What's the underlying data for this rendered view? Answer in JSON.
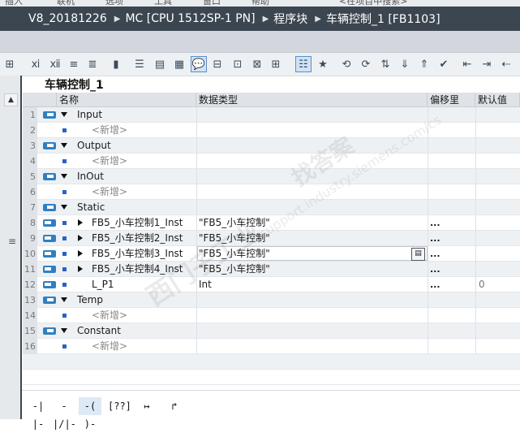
{
  "top_menu": [
    "插入",
    "联机",
    "选项",
    "工具",
    "窗口",
    "帮助"
  ],
  "top_search_placeholder": "<在项目中搜索>",
  "breadcrumb": [
    "V8_20181226",
    "MC [CPU 1512SP-1 PN]",
    "程序块",
    "车辆控制_1 [FB1103]"
  ],
  "block_title": "车辆控制_1",
  "columns": {
    "name": "名称",
    "datatype": "数据类型",
    "offset": "偏移里",
    "default": "默认值"
  },
  "rows": [
    {
      "n": "1",
      "kind": "section",
      "name": "Input"
    },
    {
      "n": "2",
      "kind": "add",
      "name": "<新增>"
    },
    {
      "n": "3",
      "kind": "section",
      "name": "Output"
    },
    {
      "n": "4",
      "kind": "add",
      "name": "<新增>"
    },
    {
      "n": "5",
      "kind": "section",
      "name": "InOut"
    },
    {
      "n": "6",
      "kind": "add",
      "name": "<新增>"
    },
    {
      "n": "7",
      "kind": "section",
      "name": "Static"
    },
    {
      "n": "8",
      "kind": "instance",
      "name": "FB5_小车控制1_Inst",
      "type": "\"FB5_小车控制\"",
      "offset": "..."
    },
    {
      "n": "9",
      "kind": "instance",
      "name": "FB5_小车控制2_Inst",
      "type": "\"FB5_小车控制\"",
      "offset": "..."
    },
    {
      "n": "10",
      "kind": "instance",
      "name": "FB5_小车控制3_Inst",
      "type": "\"FB5_小车控制\"",
      "offset": "...",
      "editing": true
    },
    {
      "n": "11",
      "kind": "instance",
      "name": "FB5_小车控制4_Inst",
      "type": "\"FB5_小车控制\"",
      "offset": "..."
    },
    {
      "n": "12",
      "kind": "var",
      "name": "L_P1",
      "type": "Int",
      "offset": "...",
      "default": "0"
    },
    {
      "n": "13",
      "kind": "section",
      "name": "Temp"
    },
    {
      "n": "14",
      "kind": "add",
      "name": "<新增>"
    },
    {
      "n": "15",
      "kind": "section",
      "name": "Constant"
    },
    {
      "n": "16",
      "kind": "add",
      "name": "<新增>"
    }
  ],
  "lad_toolbar": [
    "-| |-",
    "-|/|-",
    "-( )-",
    "[??]",
    "↦",
    "↱"
  ],
  "watermark": [
    "support.industry.siemens.com/cs",
    "找答案",
    "西门子工业"
  ],
  "colors": {
    "breadcrumb_bg": "#3c4650",
    "accent": "#2f7fc1"
  }
}
